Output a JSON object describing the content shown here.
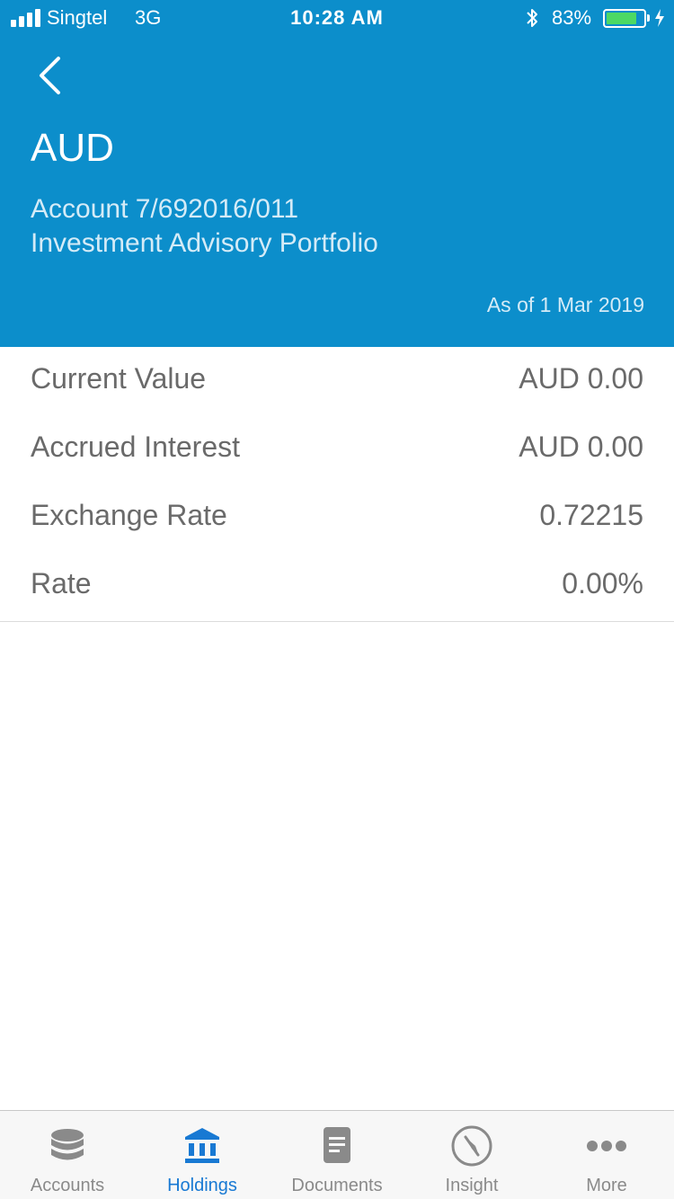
{
  "status_bar": {
    "carrier": "Singtel",
    "network": "3G",
    "time": "10:28 AM",
    "battery_percent": "83%",
    "battery_level": 0.83,
    "battery_color": "#4CD964"
  },
  "header": {
    "title": "AUD",
    "account": "Account 7/692016/011",
    "portfolio": "Investment Advisory Portfolio",
    "as_of": "As of 1 Mar 2019",
    "background": "#0C8ECB"
  },
  "details": [
    {
      "label": "Current Value",
      "value": "AUD 0.00"
    },
    {
      "label": "Accrued Interest",
      "value": "AUD 0.00"
    },
    {
      "label": "Exchange Rate",
      "value": "0.72215"
    },
    {
      "label": "Rate",
      "value": "0.00%"
    }
  ],
  "tabs": [
    {
      "label": "Accounts",
      "icon": "database-icon"
    },
    {
      "label": "Holdings",
      "icon": "bank-icon",
      "active": true
    },
    {
      "label": "Documents",
      "icon": "document-icon"
    },
    {
      "label": "Insight",
      "icon": "compass-icon"
    },
    {
      "label": "More",
      "icon": "more-icon"
    }
  ],
  "colors": {
    "tab_active": "#1879D3",
    "tab_inactive": "#8a8a8a"
  }
}
